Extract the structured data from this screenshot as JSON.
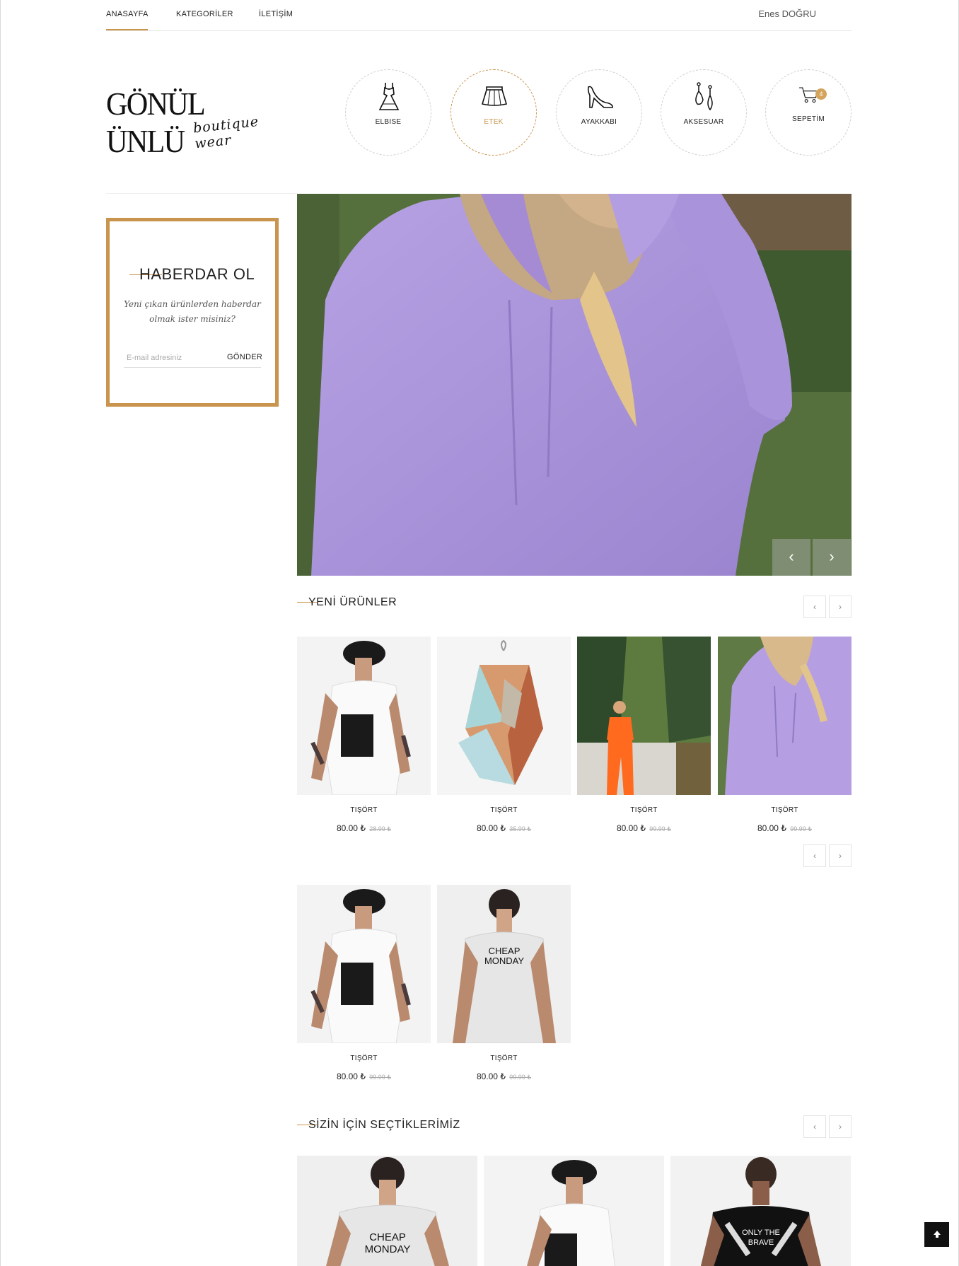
{
  "nav": {
    "items": [
      "ANASAYFA",
      "KATEGORİLER",
      "İLETİŞİM"
    ],
    "user": "Enes DOĞRU"
  },
  "brand": {
    "name": "GÖNÜL ÜNLÜ",
    "tagline": "boutique wear"
  },
  "categories": [
    {
      "label": "ELBISE",
      "icon": "dress-icon"
    },
    {
      "label": "ETEK",
      "icon": "skirt-icon",
      "active": true
    },
    {
      "label": "AYAKKABI",
      "icon": "heel-shoe-icon"
    },
    {
      "label": "AKSESUAR",
      "icon": "earrings-icon"
    },
    {
      "label": "SEPETİM",
      "icon": "cart-icon",
      "badge": "4"
    }
  ],
  "newsletter": {
    "title": "HABERDAR OL",
    "description": "Yeni çıkan ürünlerden haberdar olmak ister misiniz?",
    "email_placeholder": "E-mail adresiniz",
    "submit_label": "GÖNDER"
  },
  "hero": {
    "prev": "‹",
    "next": "›"
  },
  "sections": {
    "new_products": "YENİ ÜRÜNLER",
    "picks": "SİZİN İÇİN SEÇTİKLERİMİZ"
  },
  "products_row1": [
    {
      "name": "TIŞÖRT",
      "price": "80.00 ₺",
      "old_price": "28.99 ₺"
    },
    {
      "name": "TIŞÖRT",
      "price": "80.00 ₺",
      "old_price": "35.99 ₺"
    },
    {
      "name": "TIŞÖRT",
      "price": "80.00 ₺",
      "old_price": "99.99 ₺"
    },
    {
      "name": "TIŞÖRT",
      "price": "80.00 ₺",
      "old_price": "99.99 ₺"
    }
  ],
  "products_row2": [
    {
      "name": "TIŞÖRT",
      "price": "80.00 ₺",
      "old_price": "99.99 ₺"
    },
    {
      "name": "TIŞÖRT",
      "price": "80.00 ₺",
      "old_price": "99.99 ₺"
    }
  ],
  "tshirt_texts": {
    "cheap": "CHEAP",
    "monday": "MONDAY",
    "only": "ONLY THE",
    "brave": "BRAVE"
  },
  "colors": {
    "accent": "#c8944e",
    "badge": "#d4a45c"
  }
}
